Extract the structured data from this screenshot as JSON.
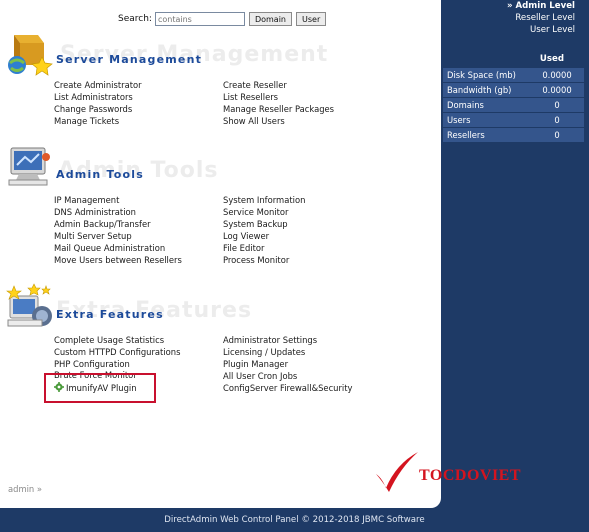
{
  "search": {
    "label": "Search:",
    "placeholder": "contains",
    "domain_button": "Domain",
    "user_button": "User"
  },
  "levels": [
    {
      "label": "» Admin Level",
      "active": true
    },
    {
      "label": "Reseller Level",
      "active": false
    },
    {
      "label": "User Level",
      "active": false
    }
  ],
  "stats": {
    "header": "Used",
    "rows": [
      {
        "label": "Disk Space (mb)",
        "value": "0.0000"
      },
      {
        "label": "Bandwidth (gb)",
        "value": "0.0000"
      },
      {
        "label": "Domains",
        "value": "0"
      },
      {
        "label": "Users",
        "value": "0"
      },
      {
        "label": "Resellers",
        "value": "0"
      }
    ]
  },
  "sections": {
    "server": {
      "ghost": "Server Management",
      "title": "Server Management",
      "left": [
        "Create Administrator",
        "List Administrators",
        "Change Passwords",
        "Manage Tickets"
      ],
      "right": [
        "Create Reseller",
        "List Resellers",
        "Manage Reseller Packages",
        "Show All Users"
      ]
    },
    "admin": {
      "ghost": "Admin Tools",
      "title": "Admin Tools",
      "left": [
        "IP Management",
        "DNS Administration",
        "Admin Backup/Transfer",
        "Multi Server Setup",
        "Mail Queue Administration",
        "Move Users between Resellers"
      ],
      "right": [
        "System Information",
        "Service Monitor",
        "System Backup",
        "Log Viewer",
        "File Editor",
        "Process Monitor"
      ]
    },
    "extra": {
      "ghost": "Extra Features",
      "title": "Extra Features",
      "left": [
        "Complete Usage Statistics",
        "Custom HTTPD Configurations",
        "PHP Configuration",
        "Brute Force Monitor",
        "ImunifyAV Plugin"
      ],
      "right": [
        "Administrator Settings",
        "Licensing / Updates",
        "Plugin Manager",
        "All User Cron Jobs",
        "ConfigServer Firewall&Security"
      ]
    }
  },
  "breadcrumb": "admin »",
  "footer": "DirectAdmin Web Control Panel © 2012-2018 JBMC Software",
  "watermark": "TOCDOVIET",
  "colors": {
    "accent": "#1c4a9a",
    "background": "#1e3a66",
    "stat_row": "#34558c",
    "highlight": "#c8102e"
  }
}
